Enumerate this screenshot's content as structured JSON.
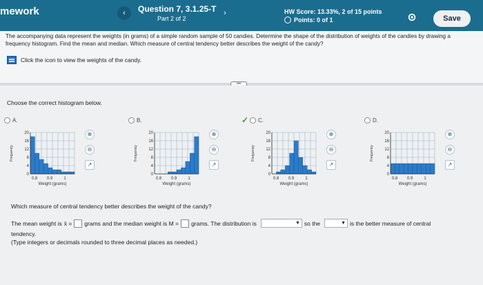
{
  "header": {
    "brand": "mework",
    "question_title": "Question 7, 3.1.25-T",
    "question_part": "Part 2 of 2",
    "hw_score": "HW Score: 13.33%, 2 of 15 points",
    "points": "Points: 0 of 1",
    "save_label": "Save",
    "prev_icon": "chevron-left-icon",
    "next_icon": "chevron-right-icon"
  },
  "prompt": {
    "text": "The accompanying data represent the weights (in grams) of a simple random sample of 50 candies. Determine the shape of the distribution of weights of the candies by drawing a frequency histogram. Find the mean and median. Which measure of central tendency better describes the weight of the candy?",
    "data_link_label": "Click the icon to view the weights of the candy."
  },
  "main": {
    "choose_label": "Choose the correct histogram below.",
    "options": [
      {
        "letter": "A.",
        "selected": false
      },
      {
        "letter": "B.",
        "selected": false
      },
      {
        "letter": "C.",
        "selected": true
      },
      {
        "letter": "D.",
        "selected": false
      }
    ],
    "question2": "Which measure of central tendency better describes the weight of the candy?",
    "answer_part1": "The mean weight is",
    "x_bar": "x̄ =",
    "answer_part2": "grams and the median weight is M =",
    "answer_part3": "grams. The distribution is",
    "answer_part4": "so the",
    "answer_part5": "is the better measure of central",
    "answer_part6": "tendency.",
    "hint": "(Type integers or decimals rounded to three decimal places as needed.)"
  },
  "chart_data": [
    {
      "type": "bar",
      "title": "",
      "xlabel": "Weight (grams)",
      "ylabel": "Frequency",
      "x_ticks": [
        "0.8",
        "0.9",
        "1"
      ],
      "y_ticks": [
        "0",
        "4",
        "8",
        "12",
        "16",
        "20"
      ],
      "ylim": [
        0,
        20
      ],
      "values": [
        18,
        10,
        7,
        5,
        3,
        2,
        2,
        1,
        1,
        1
      ]
    },
    {
      "type": "bar",
      "title": "",
      "xlabel": "Weight (grams)",
      "ylabel": "Frequency",
      "x_ticks": [
        "0.8",
        "0.9",
        "1"
      ],
      "y_ticks": [
        "0",
        "4",
        "8",
        "12",
        "16",
        "20"
      ],
      "ylim": [
        0,
        20
      ],
      "values": [
        0,
        0,
        0,
        1,
        1,
        2,
        3,
        6,
        10,
        18
      ]
    },
    {
      "type": "bar",
      "title": "",
      "xlabel": "Weight (grams)",
      "ylabel": "Frequency",
      "x_ticks": [
        "0.8",
        "0.9",
        "1"
      ],
      "y_ticks": [
        "0",
        "4",
        "8",
        "12",
        "16",
        "20"
      ],
      "ylim": [
        0,
        20
      ],
      "values": [
        0,
        1,
        2,
        4,
        10,
        16,
        8,
        4,
        2,
        1
      ]
    },
    {
      "type": "bar",
      "title": "",
      "xlabel": "Weight (grams)",
      "ylabel": "Frequency",
      "x_ticks": [
        "0.8",
        "0.9",
        "1"
      ],
      "y_ticks": [
        "0",
        "4",
        "8",
        "12",
        "16",
        "20"
      ],
      "ylim": [
        0,
        20
      ],
      "values": [
        5,
        5,
        5,
        5,
        5,
        5,
        5,
        5,
        5,
        5
      ]
    }
  ]
}
